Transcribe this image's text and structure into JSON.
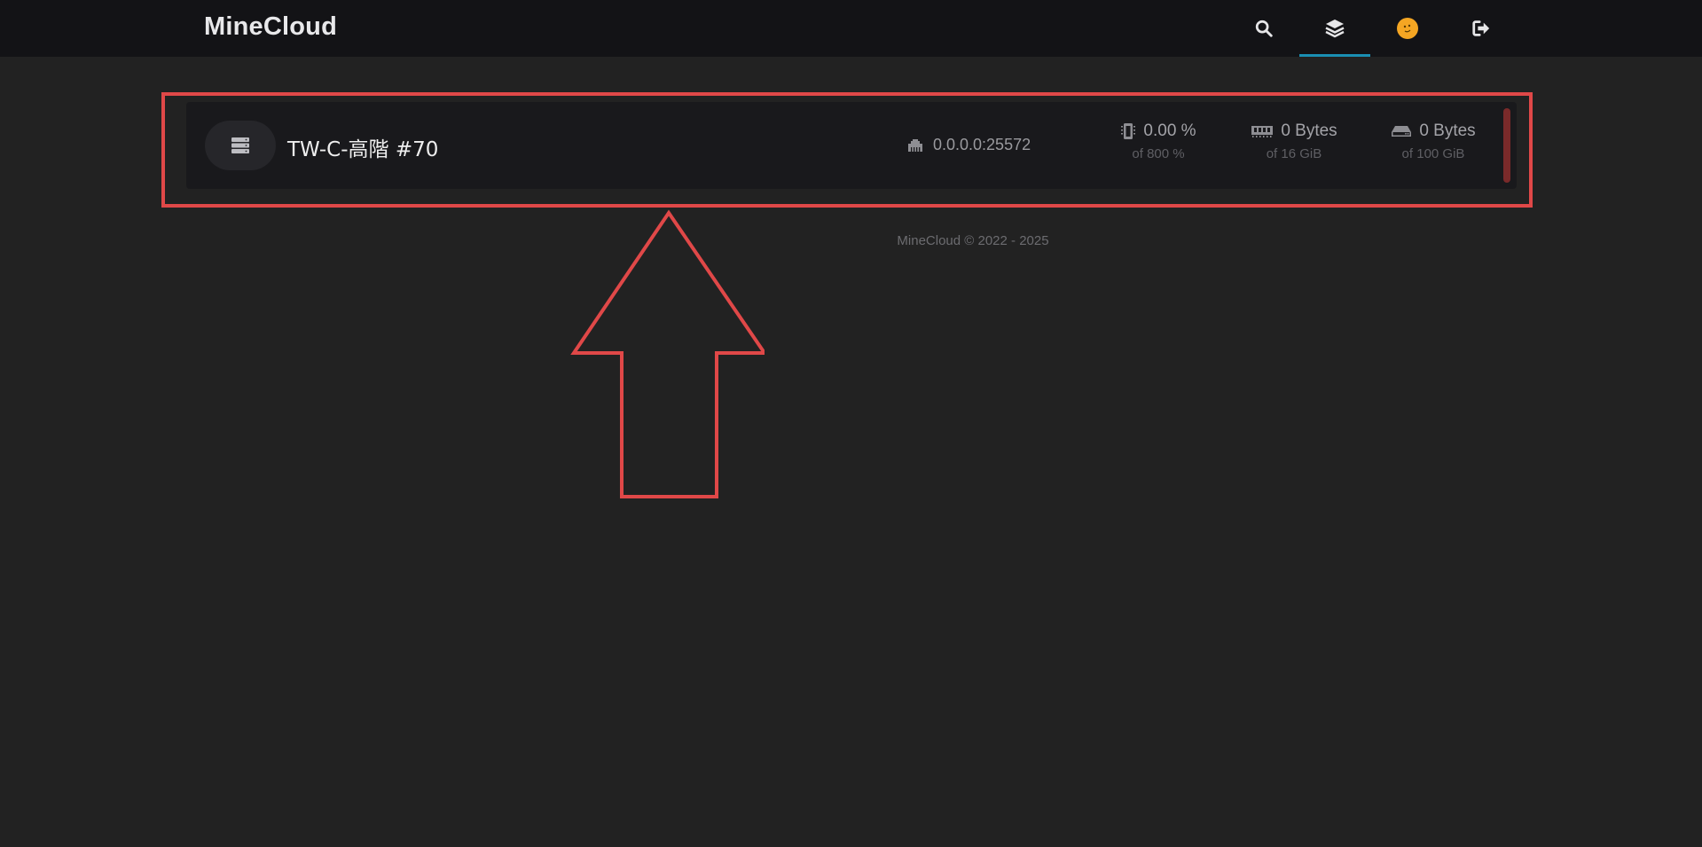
{
  "navbar": {
    "brand": "MineCloud",
    "items": [
      {
        "icon": "search-icon",
        "active": false
      },
      {
        "icon": "layers-icon",
        "active": true
      },
      {
        "icon": "avatar",
        "active": false
      },
      {
        "icon": "logout-icon",
        "active": false
      }
    ],
    "accent_color": "#1a8fb3"
  },
  "server": {
    "icon": "server-icon",
    "name": "TW-C-高階 #70",
    "address": "0.0.0.0:25572",
    "cpu": {
      "value": "0.00 %",
      "limit": "of 800 %"
    },
    "memory": {
      "value": "0 Bytes",
      "limit": "of 16 GiB"
    },
    "disk": {
      "value": "0 Bytes",
      "limit": "of 100 GiB"
    },
    "status_color": "#7a2a2a"
  },
  "footer": {
    "text": "MineCloud © 2022 - 2025"
  },
  "annotation": {
    "color": "#e04848"
  }
}
